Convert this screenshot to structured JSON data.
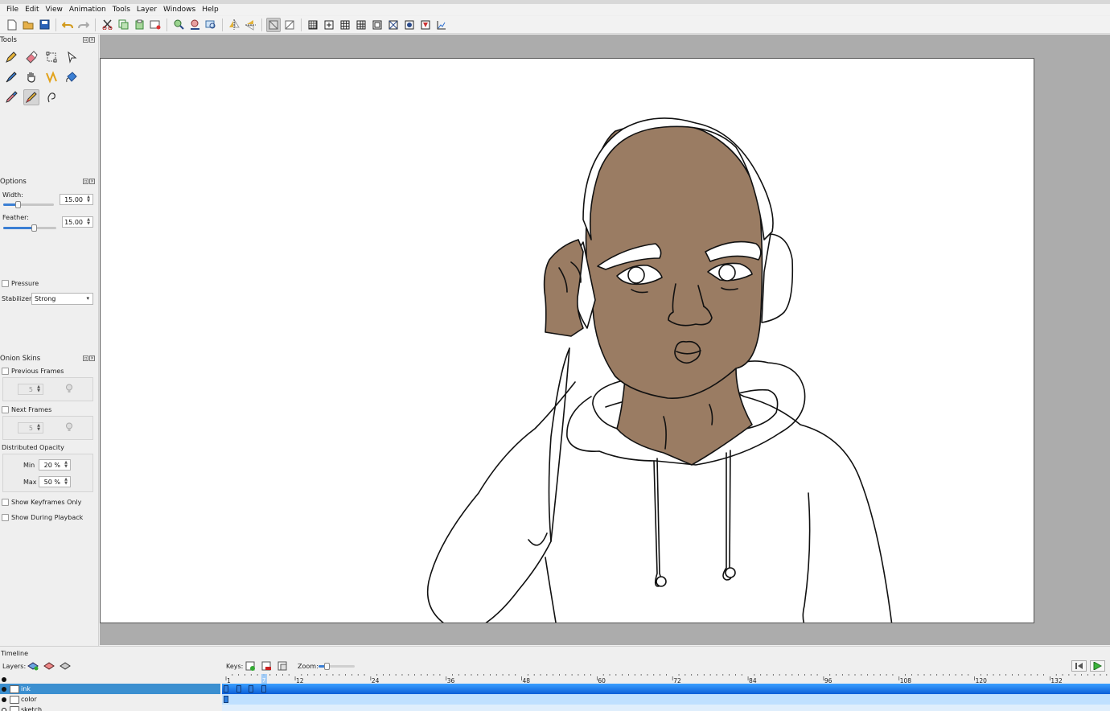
{
  "menubar": {
    "items": [
      "File",
      "Edit",
      "View",
      "Animation",
      "Tools",
      "Layer",
      "Windows",
      "Help"
    ]
  },
  "toolbar": {
    "icons": [
      "new-file-icon",
      "open-folder-icon",
      "save-icon",
      "undo-icon",
      "redo-icon",
      "cut-icon",
      "copy-icon",
      "paste-icon",
      "clear-frame-icon",
      "zoom-in-icon",
      "zoom-out-icon",
      "zoom-fit-icon",
      "flip-horizontal-icon",
      "flip-vertical-icon",
      "preview-icon",
      "grid-off-icon",
      "grid-icon",
      "center-icon",
      "thirds-icon",
      "golden-ratio-icon",
      "safe-area-icon",
      "action-safe-icon",
      "title-safe-icon",
      "overscan-icon",
      "camera-path-icon"
    ]
  },
  "tools_panel": {
    "title": "Tools",
    "tools": [
      "pencil-icon",
      "eraser-icon",
      "select-icon",
      "move-icon",
      "pen-icon",
      "hand-icon",
      "polyline-icon",
      "bucket-icon",
      "eyedropper-icon",
      "brush-icon",
      "smudge-icon"
    ],
    "active_tool": "brush-icon"
  },
  "options_panel": {
    "title": "Options",
    "width_label": "Width:",
    "width_value": "15.00",
    "width_fraction": 0.28,
    "feather_label": "Feather:",
    "feather_value": "15.00",
    "feather_fraction": 0.58,
    "pressure_label": "Pressure",
    "stabilizer_label": "Stabilizer",
    "stabilizer_value": "Strong"
  },
  "onion_panel": {
    "title": "Onion Skins",
    "previous_frames_label": "Previous Frames",
    "previous_frames_value": "5",
    "next_frames_label": "Next Frames",
    "next_frames_value": "5",
    "distributed_opacity_label": "Distributed Opacity",
    "min_label": "Min",
    "min_value": "20 %",
    "max_label": "Max",
    "max_value": "50 %",
    "show_keyframes_only_label": "Show Keyframes Only",
    "show_during_playback_label": "Show During Playback"
  },
  "timeline": {
    "title": "Timeline",
    "layers_label": "Layers:",
    "keys_label": "Keys:",
    "zoom_label": "Zoom:",
    "current_frame": "7",
    "ruler_labels": [
      "1",
      "12",
      "24",
      "36",
      "48",
      "60",
      "72",
      "84",
      "96",
      "108",
      "120",
      "132"
    ],
    "layers": [
      {
        "name": "ink",
        "selected": true,
        "visible": true
      },
      {
        "name": "color",
        "selected": false,
        "visible": true
      },
      {
        "name": "sketch",
        "selected": false,
        "visible": false
      }
    ],
    "ink_keyframes": [
      1,
      3,
      5,
      7
    ],
    "color_keyframes": [
      1
    ]
  },
  "colors": {
    "skin": "#9a7c63",
    "selection_blue": "#3b8fd0",
    "track_blue": "#1e7de0",
    "accent": "#3b7fd4"
  }
}
